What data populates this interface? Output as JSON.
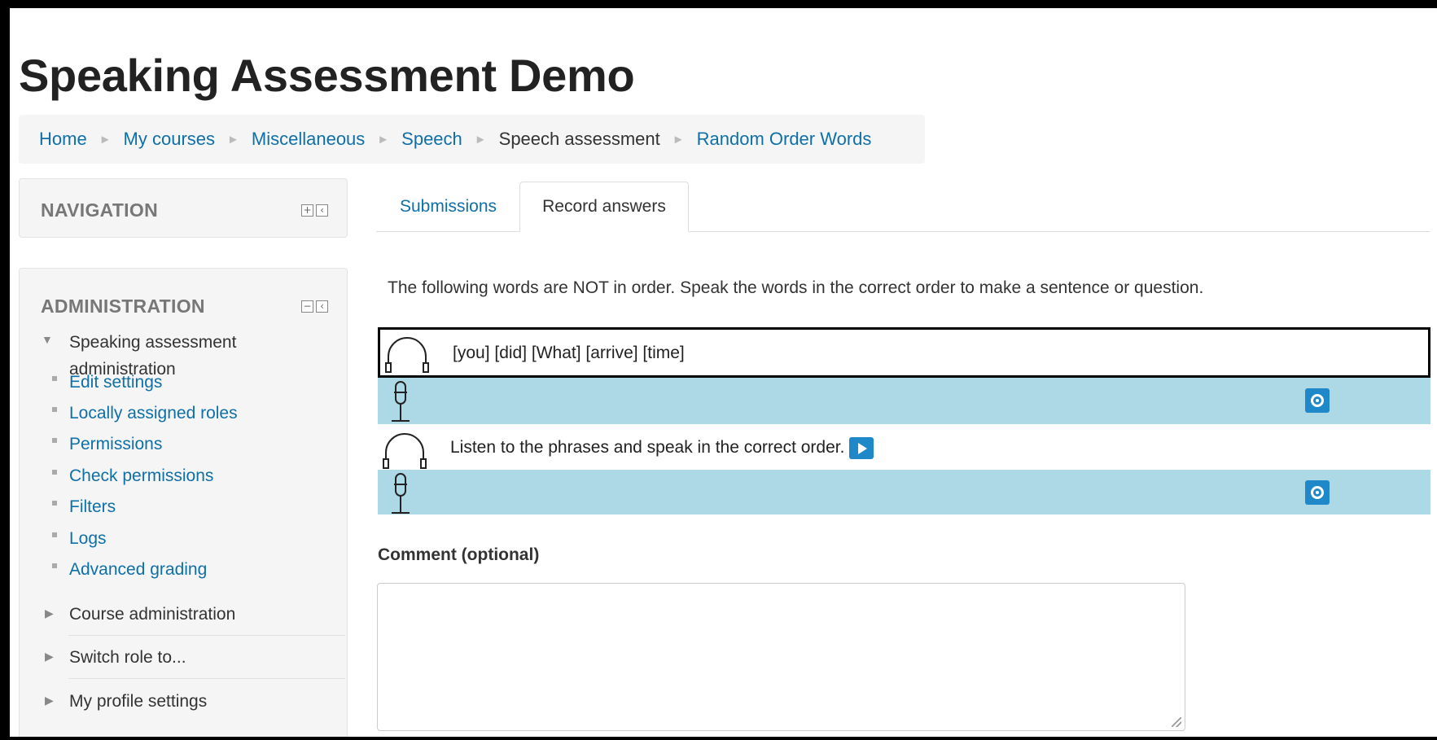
{
  "page": {
    "title": "Speaking Assessment Demo"
  },
  "breadcrumb": {
    "items": [
      {
        "label": "Home",
        "link": true
      },
      {
        "label": "My courses",
        "link": true
      },
      {
        "label": "Miscellaneous",
        "link": true
      },
      {
        "label": "Speech",
        "link": true
      },
      {
        "label": "Speech assessment",
        "link": false
      },
      {
        "label": "Random Order Words",
        "link": true
      }
    ],
    "separator": "►"
  },
  "navigation_block": {
    "title": "NAVIGATION"
  },
  "admin_block": {
    "title": "ADMINISTRATION",
    "root_label": "Speaking assessment administration",
    "items": [
      "Edit settings",
      "Locally assigned roles",
      "Permissions",
      "Check permissions",
      "Filters",
      "Logs",
      "Advanced grading"
    ],
    "collapsed": [
      "Course administration",
      "Switch role to...",
      "My profile settings"
    ]
  },
  "tabs": {
    "submissions": "Submissions",
    "record": "Record answers",
    "active": "record"
  },
  "instructions": "The following words are NOT in order. Speak the words in the correct order to make a sentence or question.",
  "prompts": [
    {
      "text": "[you] [did] [What] [arrive] [time]",
      "has_play": false,
      "selected": true
    },
    {
      "text": "Listen to the phrases and speak in the correct order.",
      "has_play": true,
      "selected": false
    }
  ],
  "comment": {
    "label": "Comment (optional)",
    "value": ""
  },
  "icons": {
    "listen": "headphones-icon",
    "speak": "microphone-icon",
    "record": "record-icon",
    "play": "play-icon",
    "block_add": "add-block-icon",
    "block_collapse": "collapse-block-icon",
    "block_dock": "dock-icon"
  },
  "colors": {
    "link": "#0f6fa7",
    "recorder_row": "#add8e6",
    "button": "#1e88c9"
  }
}
